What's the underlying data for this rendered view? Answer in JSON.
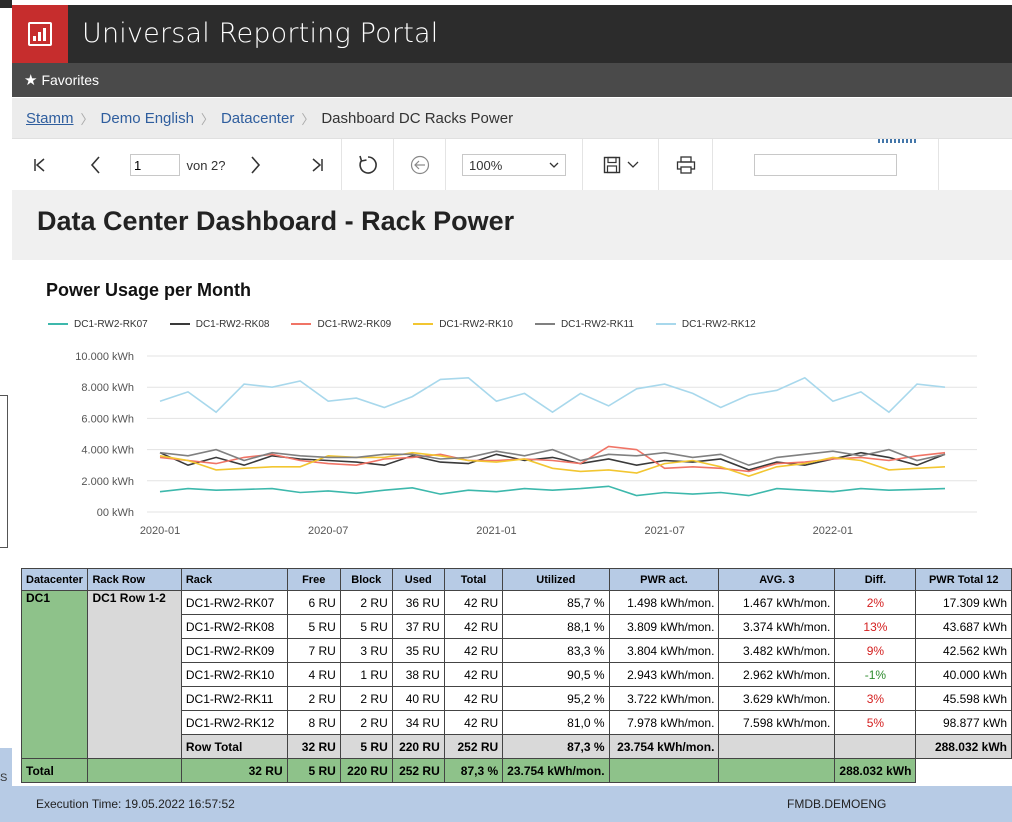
{
  "app": {
    "title": "Universal Reporting Portal"
  },
  "favorites": {
    "label": "Favorites",
    "icon": "star-icon"
  },
  "breadcrumb": [
    {
      "label": "Stamm"
    },
    {
      "label": "Demo English"
    },
    {
      "label": "Datacenter"
    },
    {
      "label": "Dashboard DC Racks Power"
    }
  ],
  "toolbar": {
    "page_value": "1",
    "page_of": "von 2?",
    "zoom": "100%"
  },
  "report": {
    "title": "Data Center Dashboard - Rack Power",
    "chart_title": "Power Usage per Month"
  },
  "chart_data": {
    "type": "line",
    "title": "Power Usage per Month",
    "x": [
      "2020-01",
      "2020-02",
      "2020-03",
      "2020-04",
      "2020-05",
      "2020-06",
      "2020-07",
      "2020-08",
      "2020-09",
      "2020-10",
      "2020-11",
      "2020-12",
      "2021-01",
      "2021-02",
      "2021-03",
      "2021-04",
      "2021-05",
      "2021-06",
      "2021-07",
      "2021-08",
      "2021-09",
      "2021-10",
      "2021-11",
      "2021-12",
      "2022-01",
      "2022-02",
      "2022-03",
      "2022-04",
      "2022-05"
    ],
    "x_tick_labels": [
      "2020-01",
      "2020-07",
      "2021-01",
      "2021-07",
      "2022-01"
    ],
    "y_tick_labels": [
      "10.000 kWh",
      "8.000 kWh",
      "6.000 kWh",
      "4.000 kWh",
      "2.000 kWh",
      "00 kWh"
    ],
    "ylim": [
      0,
      10000
    ],
    "grid": true,
    "legend_position": "top-left",
    "series": [
      {
        "name": "DC1-RW2-RK07",
        "color": "#3db8ac",
        "values": [
          1300,
          1500,
          1400,
          1450,
          1500,
          1250,
          1350,
          1200,
          1400,
          1550,
          1150,
          1400,
          1300,
          1500,
          1400,
          1500,
          1650,
          1050,
          1250,
          1150,
          1250,
          1050,
          1500,
          1400,
          1300,
          1500,
          1400,
          1450,
          1500
        ]
      },
      {
        "name": "DC1-RW2-RK08",
        "color": "#3a3a3a",
        "values": [
          3800,
          3000,
          3500,
          3000,
          3600,
          3400,
          3300,
          3200,
          3000,
          3600,
          3200,
          3100,
          3700,
          3300,
          3500,
          3100,
          3400,
          3000,
          3300,
          3200,
          3400,
          2700,
          3200,
          3000,
          3400,
          3800,
          3500,
          3000,
          3700
        ]
      },
      {
        "name": "DC1-RW2-RK09",
        "color": "#f07466",
        "values": [
          3500,
          3300,
          3100,
          3500,
          3700,
          3300,
          3100,
          3000,
          3400,
          3500,
          3700,
          3300,
          3300,
          3400,
          3300,
          3100,
          4200,
          4000,
          2800,
          2900,
          2800,
          2600,
          3100,
          3200,
          3400,
          3500,
          3300,
          3600,
          3800
        ]
      },
      {
        "name": "DC1-RW2-RK10",
        "color": "#f2c631",
        "values": [
          3600,
          3300,
          2700,
          2800,
          2900,
          2900,
          3600,
          3500,
          3500,
          3800,
          3600,
          3300,
          3200,
          3400,
          2800,
          2600,
          2700,
          2500,
          3100,
          3300,
          2900,
          2300,
          2900,
          3100,
          3500,
          3300,
          2700,
          2800,
          2900
        ]
      },
      {
        "name": "DC1-RW2-RK11",
        "color": "#808080",
        "values": [
          3800,
          3600,
          4000,
          3300,
          3800,
          3600,
          3500,
          3500,
          3700,
          3700,
          3400,
          3500,
          3900,
          3600,
          4000,
          3300,
          3700,
          3600,
          3800,
          3500,
          3700,
          3000,
          3500,
          3700,
          3900,
          3600,
          4000,
          3300,
          3700
        ]
      },
      {
        "name": "DC1-RW2-RK12",
        "color": "#a8d8ec",
        "values": [
          7100,
          7700,
          6400,
          8200,
          8000,
          8400,
          7100,
          7300,
          6700,
          7400,
          8500,
          8600,
          7100,
          7600,
          6400,
          7600,
          6800,
          7900,
          8200,
          7600,
          6700,
          7500,
          7800,
          8600,
          7100,
          7700,
          6400,
          8200,
          8000
        ]
      }
    ]
  },
  "table": {
    "headers": [
      "Datacenter",
      "Rack Row",
      "Rack",
      "Free",
      "Block",
      "Used",
      "Total",
      "Utilized",
      "PWR act.",
      "AVG. 3",
      "Diff.",
      "PWR Total 12"
    ],
    "datacenter": "DC1",
    "rack_row": "DC1 Row 1-2",
    "rows": [
      {
        "rack": "DC1-RW2-RK07",
        "free": "6 RU",
        "block": "2 RU",
        "used": "36 RU",
        "total": "42 RU",
        "utilized": "85,7 %",
        "pwr": "1.498 kWh/mon.",
        "avg": "1.467 kWh/mon.",
        "diff": "2%",
        "diff_color": "red",
        "pwr12": "17.309 kWh"
      },
      {
        "rack": "DC1-RW2-RK08",
        "free": "5 RU",
        "block": "5 RU",
        "used": "37 RU",
        "total": "42 RU",
        "utilized": "88,1 %",
        "pwr": "3.809 kWh/mon.",
        "avg": "3.374 kWh/mon.",
        "diff": "13%",
        "diff_color": "red",
        "pwr12": "43.687 kWh"
      },
      {
        "rack": "DC1-RW2-RK09",
        "free": "7 RU",
        "block": "3 RU",
        "used": "35 RU",
        "total": "42 RU",
        "utilized": "83,3 %",
        "pwr": "3.804 kWh/mon.",
        "avg": "3.482 kWh/mon.",
        "diff": "9%",
        "diff_color": "red",
        "pwr12": "42.562 kWh"
      },
      {
        "rack": "DC1-RW2-RK10",
        "free": "4 RU",
        "block": "1 RU",
        "used": "38 RU",
        "total": "42 RU",
        "utilized": "90,5 %",
        "pwr": "2.943 kWh/mon.",
        "avg": "2.962 kWh/mon.",
        "diff": "-1%",
        "diff_color": "green",
        "pwr12": "40.000 kWh"
      },
      {
        "rack": "DC1-RW2-RK11",
        "free": "2 RU",
        "block": "2 RU",
        "used": "40 RU",
        "total": "42 RU",
        "utilized": "95,2 %",
        "pwr": "3.722 kWh/mon.",
        "avg": "3.629 kWh/mon.",
        "diff": "3%",
        "diff_color": "red",
        "pwr12": "45.598 kWh"
      },
      {
        "rack": "DC1-RW2-RK12",
        "free": "8 RU",
        "block": "2 RU",
        "used": "34 RU",
        "total": "42 RU",
        "utilized": "81,0 %",
        "pwr": "7.978 kWh/mon.",
        "avg": "7.598 kWh/mon.",
        "diff": "5%",
        "diff_color": "red",
        "pwr12": "98.877 kWh"
      }
    ],
    "row_total": {
      "label": "Row Total",
      "free": "32 RU",
      "block": "5 RU",
      "used": "220 RU",
      "total": "252 RU",
      "utilized": "87,3 %",
      "pwr": "23.754 kWh/mon.",
      "pwr12": "288.032 kWh"
    },
    "grand_total": {
      "label": "Total",
      "free": "32 RU",
      "block": "5 RU",
      "used": "220 RU",
      "total": "252 RU",
      "utilized": "87,3 %",
      "pwr": "23.754 kWh/mon.",
      "pwr12": "288.032 kWh"
    }
  },
  "footer": {
    "execution": "Execution Time: 19.05.2022 16:57:52",
    "database": "FMDB.DEMOENG"
  },
  "bleed": {
    "s_letter": "S"
  }
}
